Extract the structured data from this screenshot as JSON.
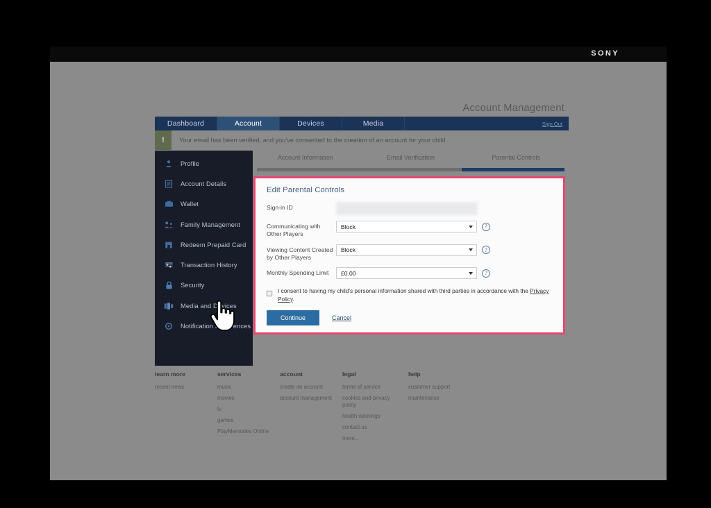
{
  "brand": {
    "logo_text": "SONY"
  },
  "header": {
    "title": "Account Management"
  },
  "main_nav": {
    "items": [
      {
        "label": "Dashboard",
        "active": false
      },
      {
        "label": "Account",
        "active": true
      },
      {
        "label": "Devices",
        "active": false
      },
      {
        "label": "Media",
        "active": false
      }
    ],
    "sign_out_label": "Sign Out"
  },
  "notification": {
    "icon": "exclamation-icon",
    "message": "Your email has been verified, and you've consented to the creation of an account for your child."
  },
  "sidebar": {
    "items": [
      {
        "label": "Profile",
        "icon": "person-icon"
      },
      {
        "label": "Account Details",
        "icon": "document-icon"
      },
      {
        "label": "Wallet",
        "icon": "wallet-icon"
      },
      {
        "label": "Family Management",
        "icon": "people-icon"
      },
      {
        "label": "Redeem Prepaid Card",
        "icon": "card-icon"
      },
      {
        "label": "Transaction History",
        "icon": "list-icon"
      },
      {
        "label": "Security",
        "icon": "lock-icon"
      },
      {
        "label": "Media and Devices",
        "icon": "devices-icon"
      },
      {
        "label": "Notification Preferences",
        "icon": "gear-icon"
      }
    ]
  },
  "steps": {
    "tabs": [
      {
        "label": "Account Information",
        "active": false
      },
      {
        "label": "Email Verification",
        "active": false
      },
      {
        "label": "Parental Controls",
        "active": true
      }
    ]
  },
  "panel": {
    "title": "Edit Parental Controls",
    "highlight_color": "#e8466d",
    "fields": [
      {
        "label": "Sign-in ID",
        "type": "readonly",
        "value": ""
      },
      {
        "label": "Communicating with Other Players",
        "type": "select",
        "value": "Block",
        "help": "?"
      },
      {
        "label": "Viewing Content Created by Other Players",
        "type": "select",
        "value": "Block",
        "help": "?"
      },
      {
        "label": "Monthly Spending Limit",
        "type": "select",
        "value": "£0.00",
        "help": "?"
      }
    ],
    "consent": {
      "checked": false,
      "text_before": "I consent to having my child's personal information shared with third parties in accordance with the ",
      "link_text": "Privacy Policy",
      "text_after": "."
    },
    "continue_label": "Continue",
    "cancel_label": "Cancel"
  },
  "footer": {
    "columns": [
      {
        "heading": "learn more",
        "links": [
          "recent news"
        ]
      },
      {
        "heading": "services",
        "links": [
          "music",
          "movies",
          "tv",
          "games",
          "PlayMemories Online"
        ]
      },
      {
        "heading": "account",
        "links": [
          "create an account",
          "account management"
        ]
      },
      {
        "heading": "legal",
        "links": [
          "terms of service",
          "cookies and privacy policy",
          "health warnings",
          "contact us",
          "more..."
        ]
      },
      {
        "heading": "help",
        "links": [
          "customer support",
          "maintenance"
        ]
      }
    ]
  },
  "cursor": {
    "type": "pointing-hand-cursor"
  }
}
